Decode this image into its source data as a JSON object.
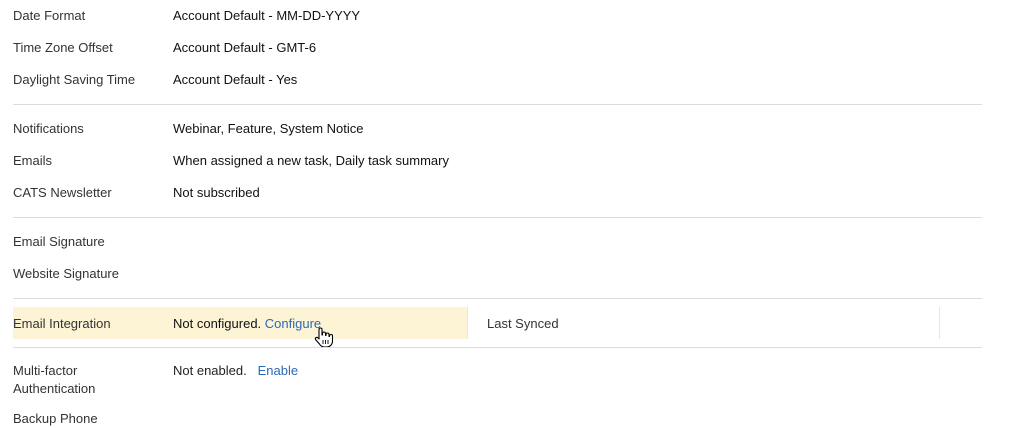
{
  "settings": {
    "date_format": {
      "label": "Date Format",
      "value": "Account Default - MM-DD-YYYY"
    },
    "time_zone": {
      "label": "Time Zone Offset",
      "value": "Account Default - GMT-6"
    },
    "dst": {
      "label": "Daylight Saving Time",
      "value": "Account Default - Yes"
    },
    "notifications": {
      "label": "Notifications",
      "value": "Webinar, Feature, System Notice"
    },
    "emails": {
      "label": "Emails",
      "value": "When assigned a new task, Daily task summary"
    },
    "newsletter": {
      "label": "CATS Newsletter",
      "value": "Not subscribed"
    },
    "email_signature": {
      "label": "Email Signature",
      "value": ""
    },
    "website_signature": {
      "label": "Website Signature",
      "value": ""
    },
    "email_integration": {
      "label": "Email Integration",
      "status": "Not configured.",
      "link": "Configure",
      "last_synced_label": "Last Synced"
    },
    "mfa": {
      "label_line1": "Multi-factor",
      "label_line2": "Authentication",
      "status": "Not enabled.",
      "link": "Enable"
    },
    "backup_phone": {
      "label": "Backup Phone"
    }
  },
  "colors": {
    "link": "#2a6ab8",
    "highlight": "#fdf4d6",
    "divider": "#dcdcdc"
  },
  "icons": {
    "cursor": "hand-pointer-icon"
  }
}
